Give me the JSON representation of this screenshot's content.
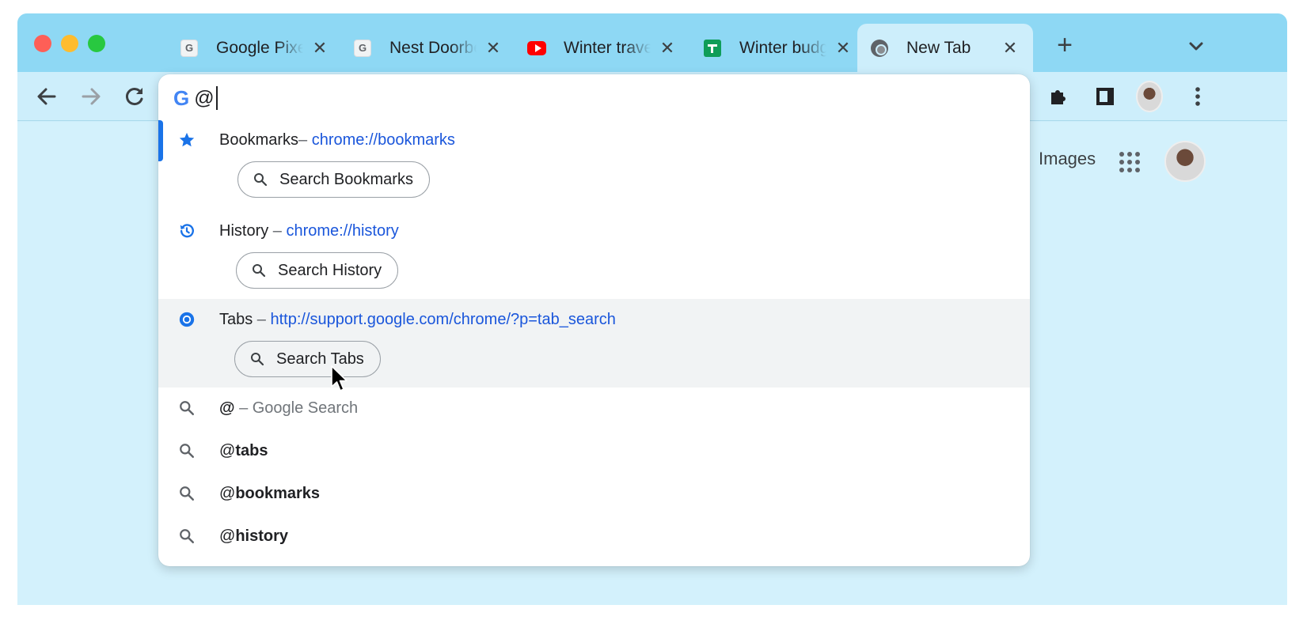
{
  "tabs": [
    {
      "title": "Google Pixel",
      "favicon": "google-g-icon",
      "close": "✕"
    },
    {
      "title": "Nest Doorbell",
      "favicon": "google-g-icon",
      "close": "✕"
    },
    {
      "title": "Winter travel",
      "favicon": "youtube-icon",
      "close": "✕"
    },
    {
      "title": "Winter budget",
      "favicon": "sheets-icon",
      "close": "✕"
    },
    {
      "title": "New Tab",
      "favicon": "chrome-icon",
      "close": "✕",
      "active": true
    }
  ],
  "tab_favicon_letter": "G",
  "new_tab_label": "+",
  "omnibox": {
    "logo": "G",
    "query": "@"
  },
  "suggestions": {
    "bookmarks": {
      "label": "Bookmarks",
      "separator": "– ",
      "url": "chrome://bookmarks",
      "action": "Search Bookmarks"
    },
    "history": {
      "label": "History",
      "separator": " – ",
      "url": "chrome://history",
      "action": "Search History"
    },
    "tabs": {
      "label": "Tabs",
      "separator": " – ",
      "url": "http://support.google.com/chrome/?p=tab_search",
      "action": "Search Tabs"
    },
    "google_search": {
      "query": "@",
      "description": " – Google Search"
    },
    "query_tabs": {
      "prefix": "@",
      "bold": "tabs"
    },
    "query_bookmarks": {
      "prefix": "@",
      "bold": "bookmarks"
    },
    "query_history": {
      "prefix": "@",
      "bold": "history"
    }
  },
  "page": {
    "images_link": "Images"
  },
  "colors": {
    "accent": "#1a73e8",
    "link": "#1a56db",
    "tabstrip": "#8ed8f4",
    "toolbar": "#cdeefb"
  }
}
